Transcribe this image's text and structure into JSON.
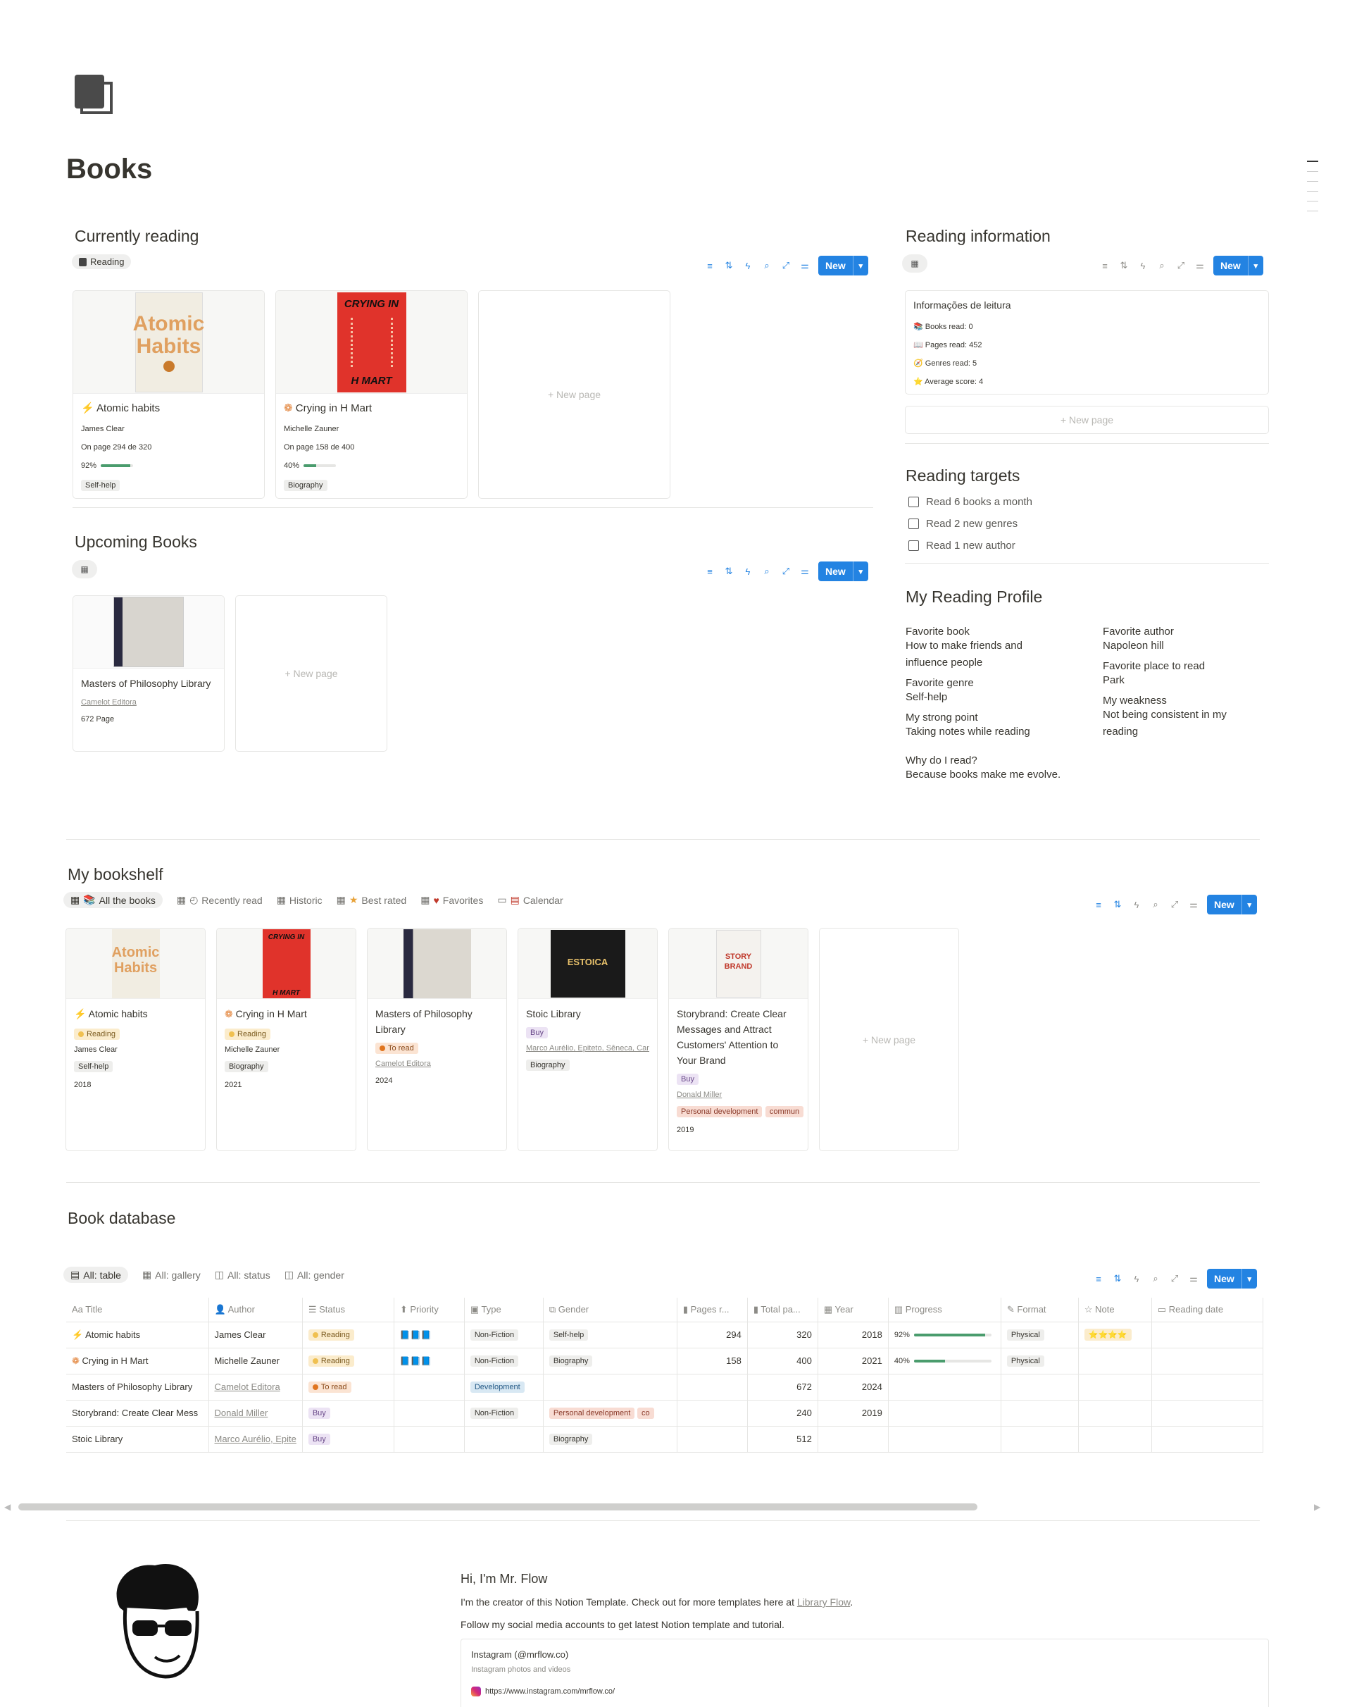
{
  "page": {
    "title": "Books"
  },
  "current": {
    "heading": "Currently reading",
    "view": "Reading",
    "new_label": "New",
    "cards": [
      {
        "title": "Atomic habits",
        "icon": "lightning-icon",
        "author": "James Clear",
        "progress_text": "On page 294 de 320",
        "percent": "92%",
        "progress": 0.92,
        "tag": "Self-help"
      },
      {
        "title": "Crying in H Mart",
        "icon": "flower-icon",
        "author": "Michelle Zauner",
        "progress_text": "On page 158 de 400",
        "percent": "40%",
        "progress": 0.4,
        "tag": "Biography"
      }
    ],
    "new_page": "+ New page"
  },
  "upcoming": {
    "heading": "Upcoming Books",
    "new_label": "New",
    "card": {
      "title": "Masters of Philosophy Library",
      "publisher": "Camelot Editora",
      "pages": "672 Page"
    },
    "new_page": "+ New page"
  },
  "info": {
    "heading": "Reading information",
    "new_label": "New",
    "card_title": "Informações de leitura",
    "stats": [
      "Books read: 0",
      "Pages read: 452",
      "Genres read: 5",
      "Average score: 4"
    ],
    "new_page": "+ New page"
  },
  "targets": {
    "heading": "Reading targets",
    "items": [
      "Read 6 books a month",
      "Read 2 new genres",
      "Read 1 new author"
    ]
  },
  "profile": {
    "heading": "My Reading Profile",
    "left": [
      {
        "label": "Favorite book",
        "value": "How to make friends and influence people"
      },
      {
        "label": "Favorite genre",
        "value": "Self-help"
      },
      {
        "label": "My strong point",
        "value": "Taking notes while reading"
      },
      {
        "label": "Why do I read?",
        "value": "Because books make me evolve."
      }
    ],
    "right": [
      {
        "label": "Favorite author",
        "value": "Napoleon hill"
      },
      {
        "label": "Favorite place to read",
        "value": "Park"
      },
      {
        "label": "My weakness",
        "value": "Not being consistent in my reading"
      }
    ]
  },
  "bookshelf": {
    "heading": "My bookshelf",
    "tabs": [
      "All the books",
      "Recently read",
      "Historic",
      "Best rated",
      "Favorites",
      "Calendar"
    ],
    "new_label": "New",
    "cards": [
      {
        "title": "Atomic habits",
        "status": "Reading",
        "author": "James Clear",
        "tag": "Self-help",
        "year": "2018"
      },
      {
        "title": "Crying in H Mart",
        "status": "Reading",
        "author": "Michelle Zauner",
        "tag": "Biography",
        "year": "2021"
      },
      {
        "title": "Masters of Philosophy Library",
        "status": "To read",
        "author": "Camelot Editora",
        "year": "2024"
      },
      {
        "title": "Stoic Library",
        "status": "Buy",
        "author": "Marco Aurélio, Epiteto, Sêneca, Cam",
        "tag": "Biography"
      },
      {
        "title": "Storybrand: Create Clear Messages and Attract Customers' Attention to Your Brand",
        "status": "Buy",
        "author": "Donald Miller",
        "tag": "Personal development",
        "tag2": "commun",
        "year": "2019"
      }
    ],
    "new_page": "+ New page"
  },
  "database": {
    "heading": "Book database",
    "tabs": [
      "All: table",
      "All: gallery",
      "All: status",
      "All: gender"
    ],
    "new_label": "New",
    "columns": [
      "Title",
      "Author",
      "Status",
      "Priority",
      "Type",
      "Gender",
      "Pages r...",
      "Total pa...",
      "Year",
      "Progress",
      "Format",
      "Note",
      "Reading date"
    ],
    "rows": [
      {
        "title": "Atomic habits",
        "author": "James Clear",
        "status": "Reading",
        "priority": "📘📘📘",
        "type": "Non-Fiction",
        "gender": "Self-help",
        "pages": "294",
        "total": "320",
        "year": "2018",
        "pct": "92%",
        "progress": 0.92,
        "format": "Physical",
        "note": "⭐⭐⭐⭐"
      },
      {
        "title": "Crying in H Mart",
        "author": "Michelle Zauner",
        "status": "Reading",
        "priority": "📘📘📘",
        "type": "Non-Fiction",
        "gender": "Biography",
        "pages": "158",
        "total": "400",
        "year": "2021",
        "pct": "40%",
        "progress": 0.4,
        "format": "Physical",
        "note": ""
      },
      {
        "title": "Masters of Philosophy Library",
        "author": "Camelot Editora",
        "status": "To read",
        "priority": "",
        "type": "Development",
        "gender": "",
        "pages": "",
        "total": "672",
        "year": "2024",
        "pct": "",
        "format": "",
        "note": ""
      },
      {
        "title": "Storybrand: Create Clear Mess",
        "author": "Donald Miller",
        "status": "Buy",
        "priority": "",
        "type": "Non-Fiction",
        "gender": "Personal development",
        "gender2": "co",
        "pages": "",
        "total": "240",
        "year": "2019",
        "pct": "",
        "format": "",
        "note": ""
      },
      {
        "title": "Stoic Library",
        "author": "Marco Aurélio, Epite",
        "status": "Buy",
        "priority": "",
        "type": "",
        "gender": "Biography",
        "pages": "",
        "total": "512",
        "year": "",
        "pct": "",
        "format": "",
        "note": ""
      }
    ]
  },
  "footer": {
    "greeting": "Hi, I'm Mr. Flow",
    "line1": "I'm the creator of this Notion Template. Check out for more templates here at ",
    "link": "Library Flow",
    "line1_end": ".",
    "line2": "Follow my social media accounts to get latest Notion template and tutorial.",
    "bookmark_title": "Instagram (@mrflow.co)",
    "bookmark_desc": "Instagram photos and videos",
    "bookmark_url": "https://www.instagram.com/mrflow.co/"
  },
  "colors": {
    "accent": "#2383e2",
    "progress": "#4a9c6d"
  }
}
